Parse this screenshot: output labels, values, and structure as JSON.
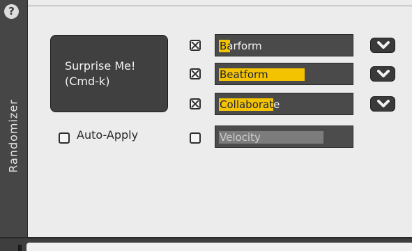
{
  "window": {
    "side_title": "Randomizer",
    "help_glyph": "?"
  },
  "surprise": {
    "line1": "Surprise Me!",
    "line2": "(Cmd-k)"
  },
  "auto_apply": {
    "label": "Auto-Apply",
    "checked": false
  },
  "rows": [
    {
      "label": "Barform",
      "checked": true,
      "level": 0.09,
      "has_dropdown": true
    },
    {
      "label": "Beatform",
      "checked": true,
      "level": 0.64,
      "has_dropdown": true
    },
    {
      "label": "Collaborate",
      "checked": true,
      "level": 0.41,
      "has_dropdown": true
    },
    {
      "label": "Velocity",
      "checked": false,
      "level": 0.78,
      "has_dropdown": false
    }
  ],
  "colors": {
    "accent": "#f3c200",
    "dark": "#404040"
  },
  "icons": {
    "help": "question-icon",
    "dropdown": "chevron-down-icon",
    "check": "x-check-icon"
  }
}
